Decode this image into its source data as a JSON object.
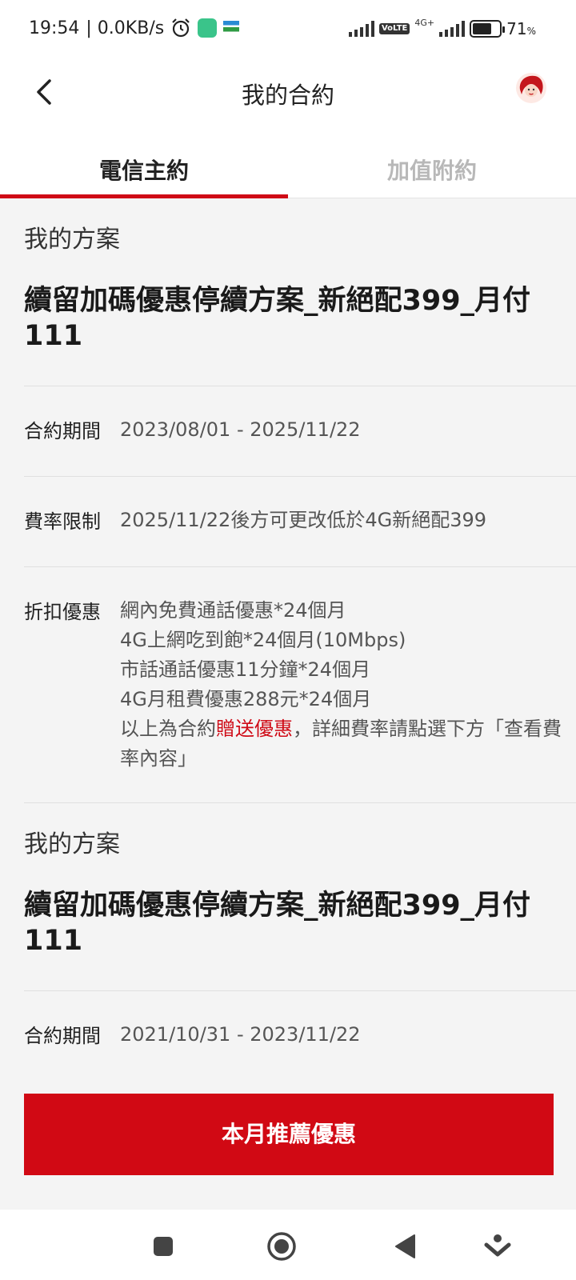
{
  "status_bar": {
    "time": "19:54",
    "speed": "| 0.0KB/s",
    "volte": "Vo\nLTE",
    "network": "4G+",
    "battery_percent": "71",
    "battery_unit": "%",
    "battery_level": 0.71
  },
  "header": {
    "title": "我的合約",
    "back_icon": "chevron-left-icon",
    "avatar_icon": "avatar-icon"
  },
  "tabs": [
    {
      "label": "電信主約",
      "active": true
    },
    {
      "label": "加值附約",
      "active": false
    }
  ],
  "plans": [
    {
      "section_label": "我的方案",
      "plan_name": "續留加碼優惠停續方案_新絕配399_月付111",
      "contract_period_label": "合約期間",
      "contract_period": "2023/08/01 - 2025/11/22",
      "rate_limit_label": "費率限制",
      "rate_limit": "2025/11/22後方可更改低於4G新絕配399",
      "discount_label": "折扣優惠",
      "discounts": [
        "網內免費通話優惠*24個月",
        "4G上網吃到飽*24個月(10Mbps)",
        "市話通話優惠11分鐘*24個月",
        "4G月租費優惠288元*24個月"
      ],
      "note_prefix": "以上為合約",
      "note_highlight": "贈送優惠",
      "note_suffix": "，詳細費率請點選下方「查看費率內容」"
    },
    {
      "section_label": "我的方案",
      "plan_name": "續留加碼優惠停續方案_新絕配399_月付111",
      "contract_period_label": "合約期間",
      "contract_period": "2021/10/31 - 2023/11/22"
    }
  ],
  "promo_button": {
    "label": "本月推薦優惠"
  },
  "colors": {
    "accent": "#cf0a16",
    "button": "#d10914",
    "background": "#f4f4f4"
  },
  "nav_bar": {
    "icons": [
      "square-icon",
      "circle-home-icon",
      "triangle-back-icon",
      "download-icon"
    ]
  }
}
